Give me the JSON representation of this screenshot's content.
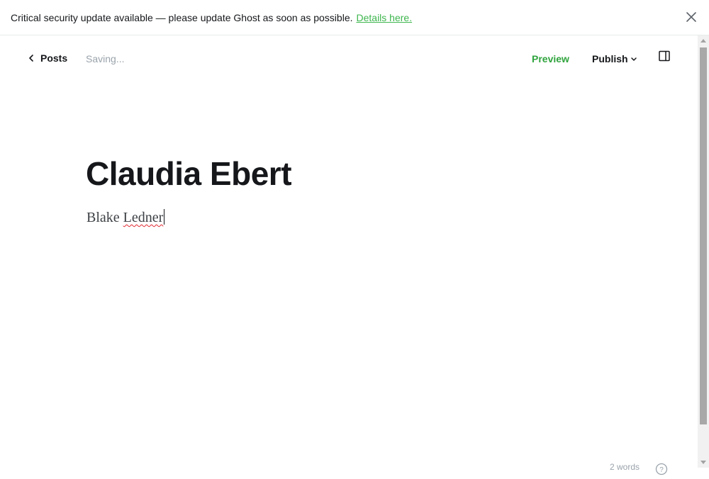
{
  "banner": {
    "message": "Critical security update available — please update Ghost as soon as possible.",
    "details_link": "Details here.",
    "close_icon": "close-icon"
  },
  "header": {
    "back_label": "Posts",
    "back_icon": "chevron-left-icon",
    "status": "Saving...",
    "preview_label": "Preview",
    "publish_label": "Publish",
    "publish_icon": "chevron-down-icon",
    "sidebar_icon": "sidebar-toggle-icon"
  },
  "post": {
    "title": "Claudia Ebert",
    "body_first": "Blake",
    "body_misspelled": "Ledner"
  },
  "footer": {
    "word_count": "2 words",
    "help_icon": "help-icon"
  },
  "colors": {
    "accent_green": "#30a43e",
    "text_dark": "#15171a",
    "muted": "#9aa3ab",
    "spellcheck_red": "#e0282e"
  }
}
